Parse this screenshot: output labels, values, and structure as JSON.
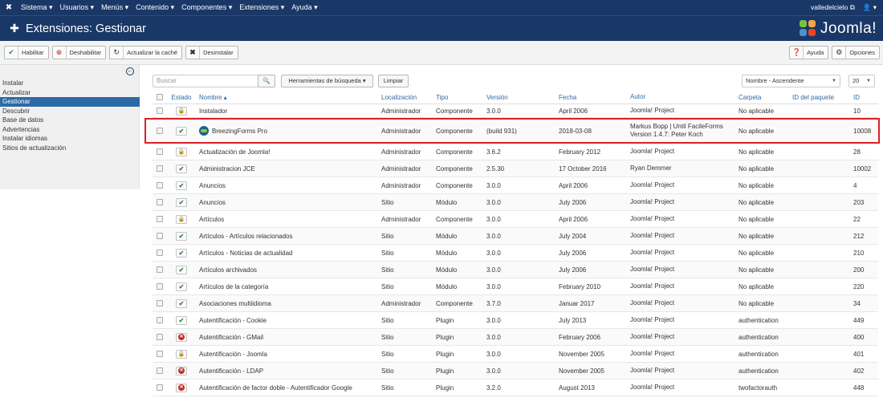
{
  "topbar": {
    "menus": [
      "Sistema ▾",
      "Usuarios ▾",
      "Menús ▾",
      "Contenido ▾",
      "Componentes ▾",
      "Extensiones ▾",
      "Ayuda ▾"
    ],
    "site": "valledelcielo",
    "user_icon": "user-icon"
  },
  "title": "Extensiones: Gestionar",
  "logo_text": "Joomla!",
  "toolbar": {
    "habilitar": "Habilitar",
    "deshabilitar": "Deshabilitar",
    "actualizar_cache": "Actualizar la caché",
    "desinstalar": "Desinstalar",
    "ayuda": "Ayuda",
    "opciones": "Opciones"
  },
  "sidebar": {
    "items": [
      {
        "label": "Instalar"
      },
      {
        "label": "Actualizar"
      },
      {
        "label": "Gestionar",
        "active": true
      },
      {
        "label": "Descubrir"
      },
      {
        "label": "Base de datos"
      },
      {
        "label": "Advertencias"
      },
      {
        "label": "Instalar idiomas"
      },
      {
        "label": "Sitios de actualización"
      }
    ]
  },
  "filters": {
    "search_placeholder": "Buscar",
    "search_tools": "Herramientas de búsqueda ▾",
    "clear": "Limpiar",
    "order": "Nombre - Ascendente",
    "limit": "20"
  },
  "columns": {
    "estado": "Estado",
    "nombre": "Nombre ▴",
    "localizacion": "Localización",
    "tipo": "Tipo",
    "version": "Versión",
    "fecha": "Fecha",
    "autor": "Autor",
    "carpeta": "Carpeta",
    "paquete": "ID del paquete",
    "id": "ID"
  },
  "rows": [
    {
      "state": "lock",
      "name": "Instalador",
      "loc": "Administrador",
      "type": "Componente",
      "ver": "3.0.0",
      "date": "April 2006",
      "author": "Joomla! Project",
      "folder": "No aplicable",
      "id": "10"
    },
    {
      "state": "ok",
      "name": "BreezingForms Pro",
      "icon": true,
      "loc": "Administrador",
      "type": "Componente",
      "ver": "(build 931)",
      "date": "2018-03-08",
      "author": "Markus Bopp | Until FacileForms Version 1.4.7: Peter Koch",
      "folder": "No aplicable",
      "id": "10008",
      "highlight": true
    },
    {
      "state": "lock",
      "name": "Actualización de Joomla!",
      "loc": "Administrador",
      "type": "Componente",
      "ver": "3.6.2",
      "date": "February 2012",
      "author": "Joomla! Project",
      "folder": "No aplicable",
      "id": "28"
    },
    {
      "state": "ok",
      "name": "Administracion JCE",
      "loc": "Administrador",
      "type": "Componente",
      "ver": "2.5.30",
      "date": "17 October 2016",
      "author": "Ryan Demmer",
      "folder": "No aplicable",
      "id": "10002"
    },
    {
      "state": "ok",
      "name": "Anuncios",
      "loc": "Administrador",
      "type": "Componente",
      "ver": "3.0.0",
      "date": "April 2006",
      "author": "Joomla! Project",
      "folder": "No aplicable",
      "id": "4"
    },
    {
      "state": "ok",
      "name": "Anuncios",
      "loc": "Sitio",
      "type": "Módulo",
      "ver": "3.0.0",
      "date": "July 2006",
      "author": "Joomla! Project",
      "folder": "No aplicable",
      "id": "203"
    },
    {
      "state": "lock",
      "name": "Artículos",
      "loc": "Administrador",
      "type": "Componente",
      "ver": "3.0.0",
      "date": "April 2006",
      "author": "Joomla! Project",
      "folder": "No aplicable",
      "id": "22"
    },
    {
      "state": "ok",
      "name": "Artículos - Artículos relacionados",
      "loc": "Sitio",
      "type": "Módulo",
      "ver": "3.0.0",
      "date": "July 2004",
      "author": "Joomla! Project",
      "folder": "No aplicable",
      "id": "212"
    },
    {
      "state": "ok",
      "name": "Artículos - Noticias de actualidad",
      "loc": "Sitio",
      "type": "Módulo",
      "ver": "3.0.0",
      "date": "July 2006",
      "author": "Joomla! Project",
      "folder": "No aplicable",
      "id": "210"
    },
    {
      "state": "ok",
      "name": "Artículos archivados",
      "loc": "Sitio",
      "type": "Módulo",
      "ver": "3.0.0",
      "date": "July 2006",
      "author": "Joomla! Project",
      "folder": "No aplicable",
      "id": "200"
    },
    {
      "state": "ok",
      "name": "Artículos de la categoría",
      "loc": "Sitio",
      "type": "Módulo",
      "ver": "3.0.0",
      "date": "February 2010",
      "author": "Joomla! Project",
      "folder": "No aplicable",
      "id": "220"
    },
    {
      "state": "ok",
      "name": "Asociaciones multiidioma",
      "loc": "Administrador",
      "type": "Componente",
      "ver": "3.7.0",
      "date": "Januar 2017",
      "author": "Joomla! Project",
      "folder": "No aplicable",
      "id": "34"
    },
    {
      "state": "ok",
      "name": "Autentificación - Cookie",
      "loc": "Sitio",
      "type": "Plugin",
      "ver": "3.0.0",
      "date": "July 2013",
      "author": "Joomla! Project",
      "folder": "authentication",
      "id": "449"
    },
    {
      "state": "no",
      "name": "Autentificación - GMail",
      "loc": "Sitio",
      "type": "Plugin",
      "ver": "3.0.0",
      "date": "February 2006",
      "author": "Joomla! Project",
      "folder": "authentication",
      "id": "400"
    },
    {
      "state": "lock",
      "name": "Autentificación - Joomla",
      "loc": "Sitio",
      "type": "Plugin",
      "ver": "3.0.0",
      "date": "November 2005",
      "author": "Joomla! Project",
      "folder": "authentication",
      "id": "401"
    },
    {
      "state": "no",
      "name": "Autentificación - LDAP",
      "loc": "Sitio",
      "type": "Plugin",
      "ver": "3.0.0",
      "date": "November 2005",
      "author": "Joomla! Project",
      "folder": "authentication",
      "id": "402"
    },
    {
      "state": "no",
      "name": "Autentificación de factor doble - Autentificador Google",
      "loc": "Sitio",
      "type": "Plugin",
      "ver": "3.2.0",
      "date": "August 2013",
      "author": "Joomla! Project",
      "folder": "twofactorauth",
      "id": "448"
    }
  ]
}
